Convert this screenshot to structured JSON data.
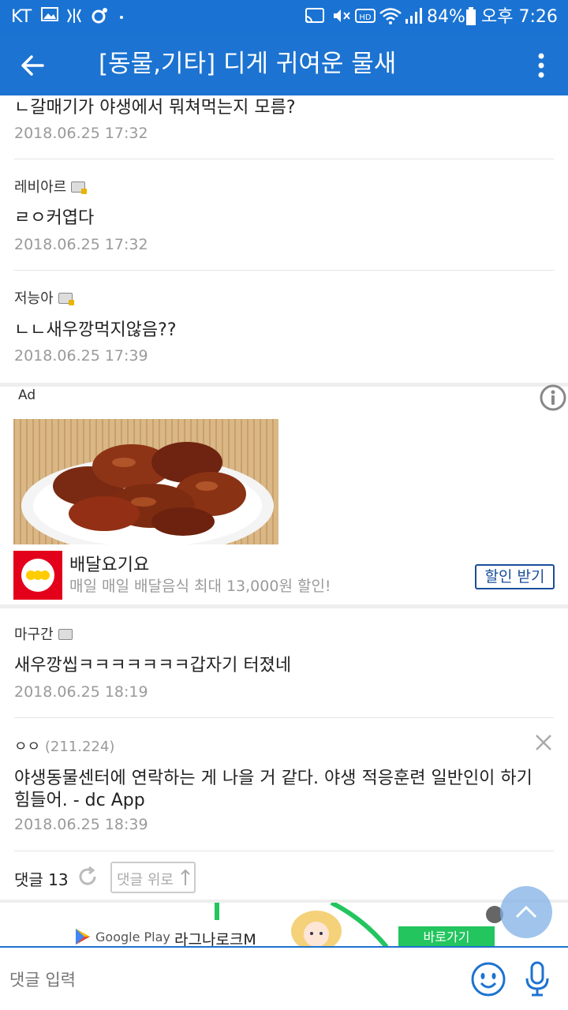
{
  "status": {
    "carrier": "KT",
    "battery": "84%",
    "time": "오후 7:26"
  },
  "header": {
    "title": "[동물,기타] 디게 귀여운 물새"
  },
  "comments": [
    {
      "text": "ㄴ갈매기가 야생에서 뭐쳐먹는지 모름?",
      "date": "2018.06.25 17:32"
    },
    {
      "nick": "레비아르",
      "text": "ㄹㅇ커엽다",
      "date": "2018.06.25 17:32"
    },
    {
      "nick": "저능아",
      "text": "ㄴㄴ새우깡먹지않음??",
      "date": "2018.06.25 17:39"
    }
  ],
  "ad": {
    "label": "Ad",
    "brand": "배달요기요",
    "desc": "매일 매일 배달음식 최대 13,000원 할인!",
    "cta": "할인 받기",
    "logo_text": "yo gi yo"
  },
  "comments2": [
    {
      "nick": "마구간",
      "text": "새우깡씹ㅋㅋㅋㅋㅋㅋㅋ갑자기 터졌네",
      "date": "2018.06.25 18:19"
    },
    {
      "nick": "ㅇㅇ",
      "ip": "(211.224)",
      "text": "야생동물센터에 연락하는 게 나을 거 같다. 야생 적응훈련 일반인이 하기",
      "text2": "힘들어. - dc App",
      "date": "2018.06.25 18:39"
    }
  ],
  "footer": {
    "count_label": "댓글 13",
    "up_label": "댓글 위로"
  },
  "banner": {
    "store": "Google Play",
    "game": "라그나로크M",
    "cta": "바로가기"
  },
  "input": {
    "placeholder": "댓글 입력"
  },
  "colors": {
    "primary": "#1c73d1",
    "date_gray": "#9a9a9a",
    "cta_blue": "#1a4e9a",
    "banner_green": "#22c55e"
  }
}
